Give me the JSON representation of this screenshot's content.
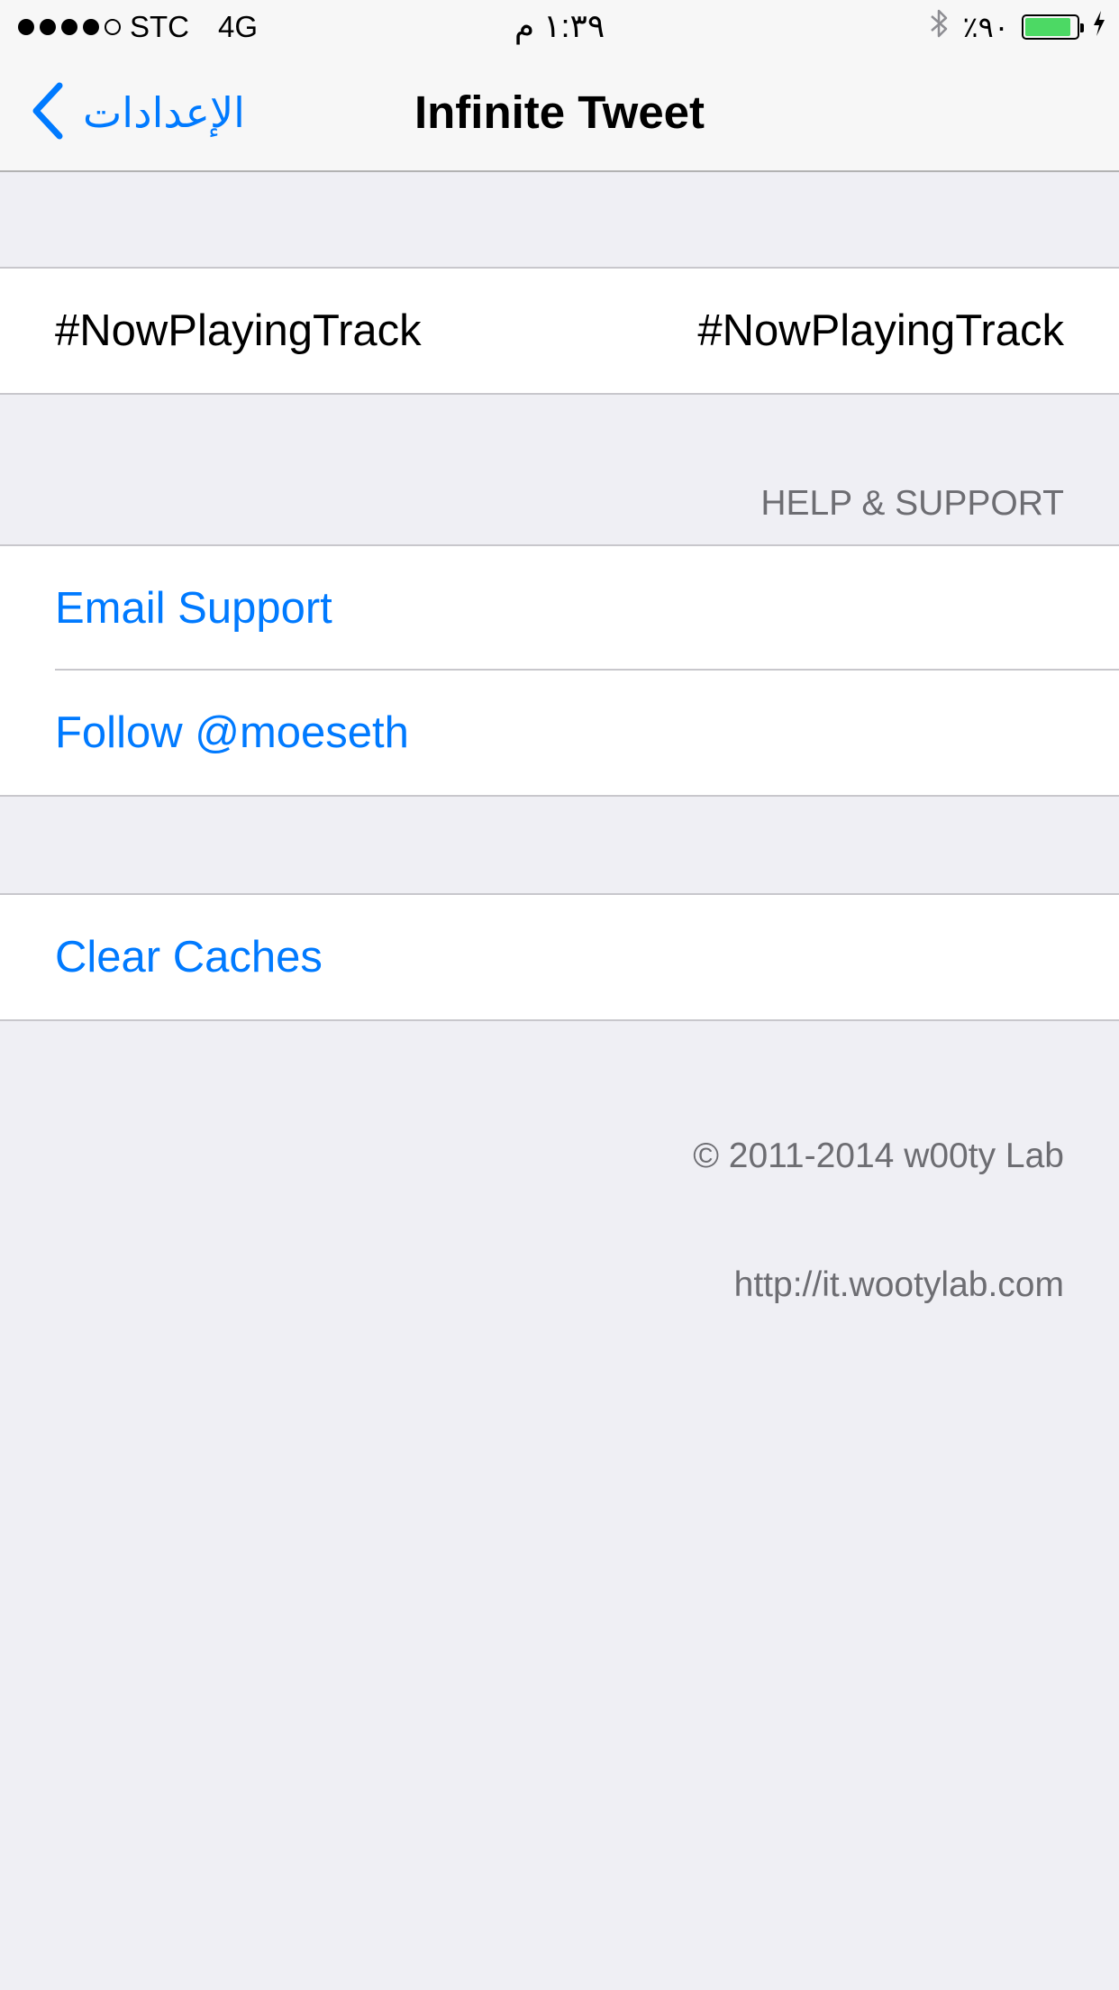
{
  "status_bar": {
    "signal_filled": 4,
    "signal_total": 5,
    "carrier": "STC",
    "network": "4G",
    "time": "١:٣٩ م",
    "battery_percent": "٪٩٠",
    "battery_level": 0.9,
    "battery_color": "#4cd964"
  },
  "nav": {
    "back_label": "الإعدادات",
    "title": "Infinite Tweet"
  },
  "hashtag_row": {
    "label": "#NowPlayingTrack",
    "value": "#NowPlayingTrack"
  },
  "help_section": {
    "header": "HELP & SUPPORT",
    "items": [
      {
        "label": "Email Support"
      },
      {
        "label": "Follow @moeseth"
      }
    ]
  },
  "clear_caches": {
    "label": "Clear Caches"
  },
  "footer": {
    "copyright": "© 2011-2014 w00ty Lab",
    "url": "http://it.wootylab.com"
  },
  "colors": {
    "accent": "#007aff",
    "background": "#efeff4"
  }
}
